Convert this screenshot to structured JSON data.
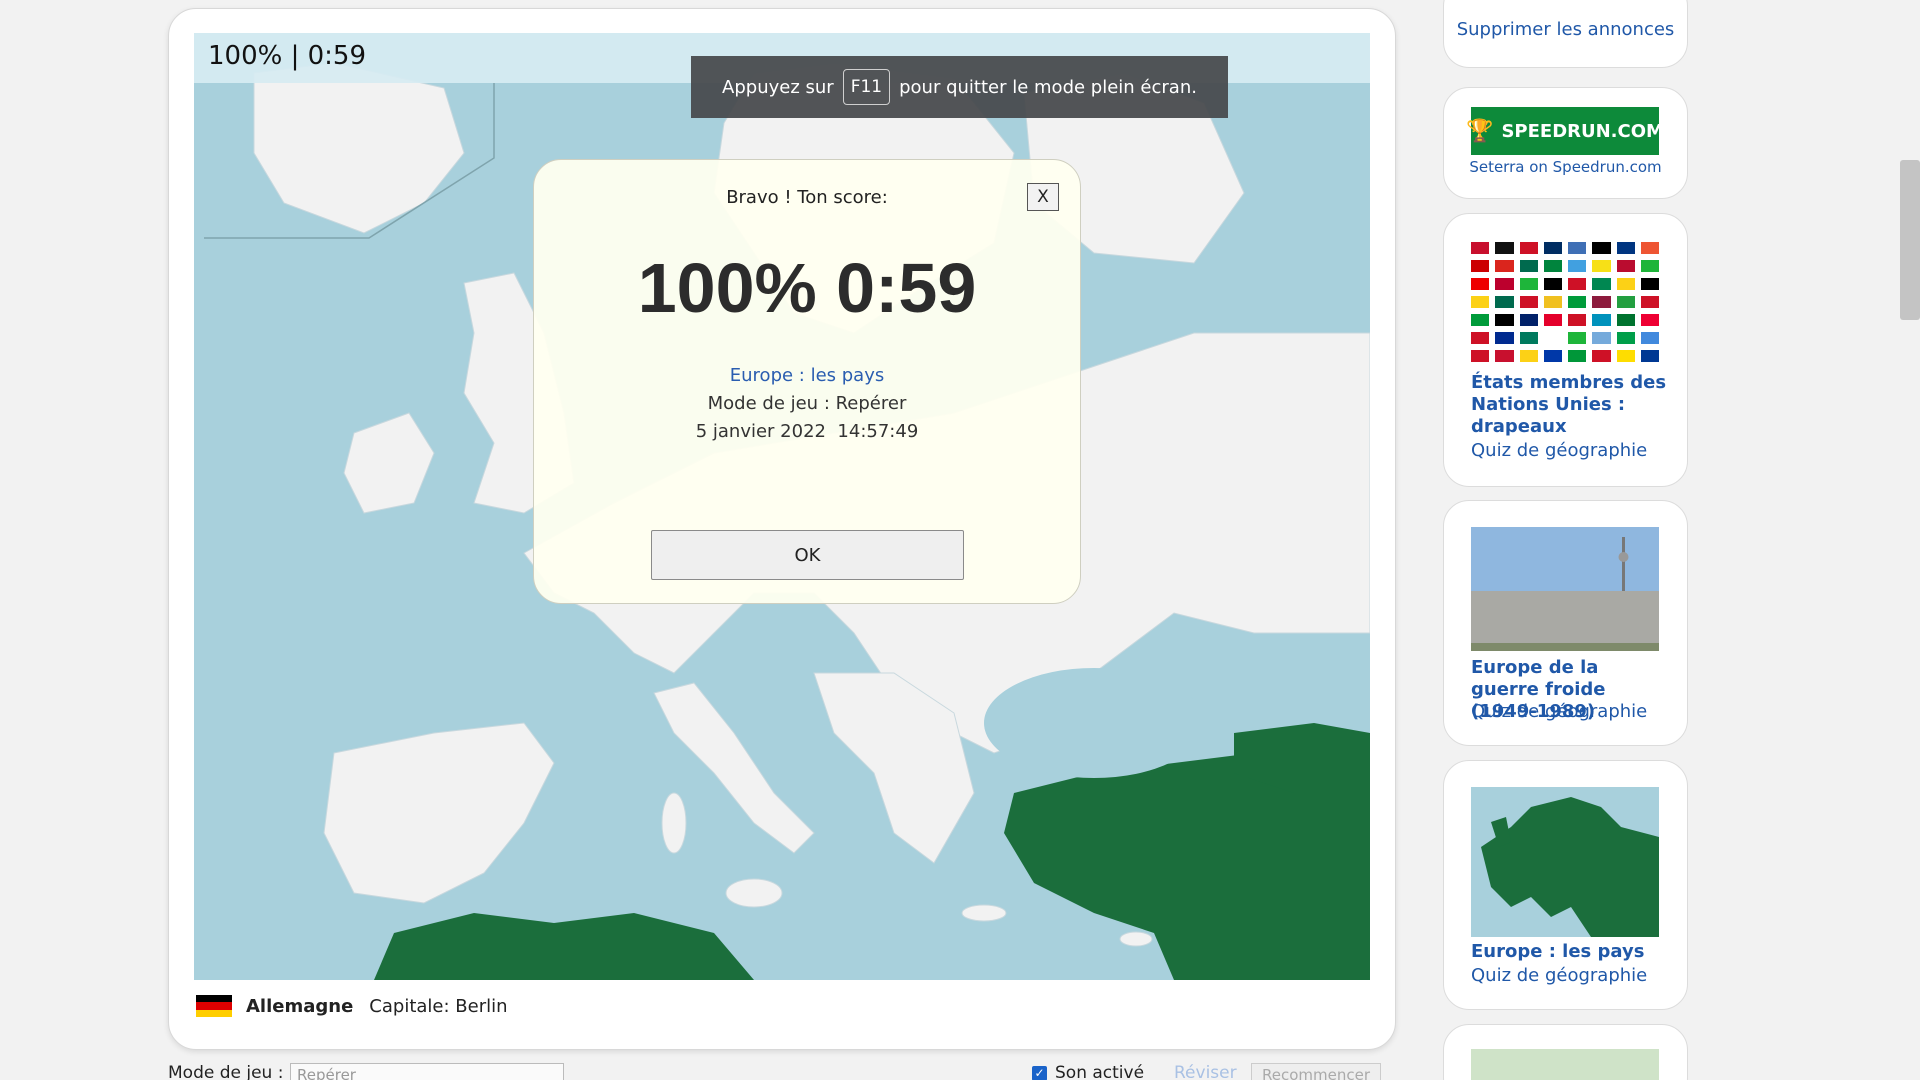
{
  "game": {
    "score_line": "100% | 0:59",
    "fullscreen_notice": {
      "before": "Appuyez sur",
      "key": "F11",
      "after": "pour quitter le mode plein écran."
    },
    "dialog": {
      "heading": "Bravo ! Ton score:",
      "close_label": "X",
      "score": "100% 0:59",
      "quiz_name": "Europe : les pays",
      "mode": "Mode de jeu : Repérer",
      "date": "5 janvier 2022  14:57:49",
      "ok_label": "OK"
    },
    "current_country": {
      "name": "Allemagne",
      "capital": "Capitale: Berlin"
    },
    "controls": {
      "mode_label": "Mode de jeu :",
      "mode_value": "Repérer",
      "sound_label": "Son activé",
      "sound_checked": true,
      "revise_label": "Réviser",
      "restart_label": "Recommencer"
    }
  },
  "sidebar": {
    "remove_ads": "Supprimer les annonces",
    "speedrun": {
      "logo_text": "SPEEDRUN.COM",
      "caption": "Seterra on Speedrun.com"
    },
    "quizzes": [
      {
        "title": "États membres des Nations Unies : drapeaux",
        "subtitle": "Quiz de géographie",
        "thumb": "flags-grid"
      },
      {
        "title": "Europe de la guerre froide (1949-1989)",
        "subtitle": "Quiz de géographie",
        "thumb": "berlin-wall"
      },
      {
        "title": "Europe : les pays",
        "subtitle": "Quiz de géographie",
        "thumb": "europe-map"
      }
    ]
  },
  "colors": {
    "sea": "#a8d0dc",
    "land": "#f2f2f2",
    "found_country": "#1b6e3c",
    "link": "#2058a8",
    "dialog_bg": "#fffff0"
  }
}
